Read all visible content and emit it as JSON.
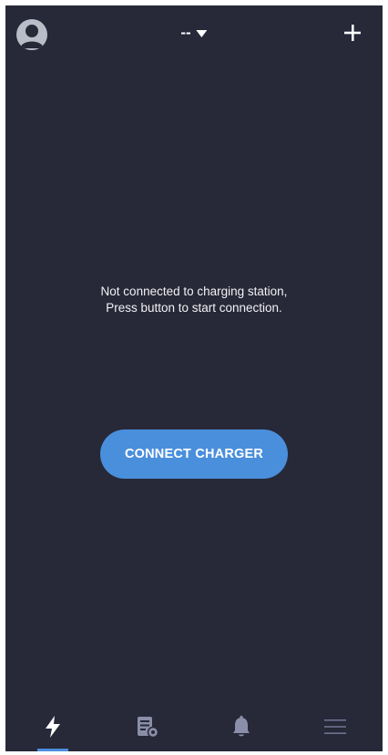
{
  "header": {
    "station_label": "--",
    "avatar_icon": "user-avatar-icon",
    "caret_icon": "caret-down-icon",
    "add_icon": "plus-icon"
  },
  "message": {
    "line1": "Not connected to charging station,",
    "line2": "Press button to start connection."
  },
  "connect_button": {
    "label": "CONNECT CHARGER"
  },
  "bottom_nav": {
    "items": [
      {
        "icon": "lightning-bolt-icon",
        "active": true
      },
      {
        "icon": "document-settings-icon",
        "active": false
      },
      {
        "icon": "bell-icon",
        "active": false
      },
      {
        "icon": "hamburger-menu-icon",
        "active": false
      }
    ]
  },
  "colors": {
    "background": "#272838",
    "accent": "#4a8fdc",
    "text": "#ffffff",
    "icon_inactive": "#8a8ea8"
  }
}
